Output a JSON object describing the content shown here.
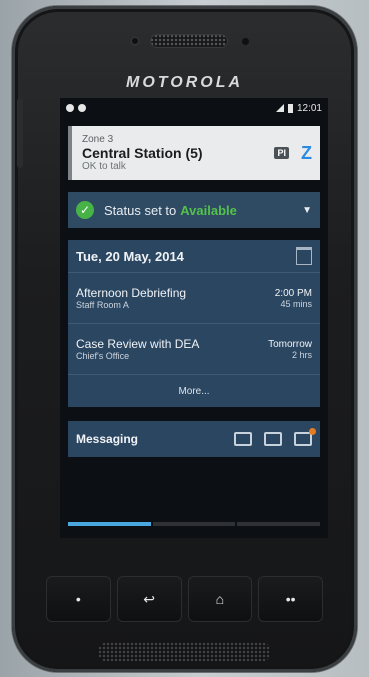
{
  "device": {
    "brand": "MOTOROLA"
  },
  "statusbar": {
    "time": "12:01"
  },
  "zone_card": {
    "zone_label": "Zone 3",
    "channel_name": "Central Station (5)",
    "talk_status": "OK to talk",
    "badge_text": "PI"
  },
  "status_card": {
    "prefix": "Status set to",
    "status_value": "Available",
    "status_color": "#53c24a"
  },
  "calendar": {
    "date": "Tue, 20 May, 2014",
    "items": [
      {
        "title": "Afternoon Debriefing",
        "location": "Staff Room A",
        "time": "2:00 PM",
        "duration": "45 mins"
      },
      {
        "title": "Case Review with DEA",
        "location": "Chief's Office",
        "time": "Tomorrow",
        "duration": "2 hrs"
      }
    ],
    "more_label": "More..."
  },
  "messaging": {
    "title": "Messaging"
  },
  "page_indicator": {
    "pages": 3,
    "active": 1
  },
  "nav": {
    "items": [
      "•",
      "↩",
      "⌂",
      "••"
    ]
  },
  "colors": {
    "accent_blue": "#4aa8e0",
    "card_bg": "#2b4661",
    "check_green": "#47b347"
  }
}
